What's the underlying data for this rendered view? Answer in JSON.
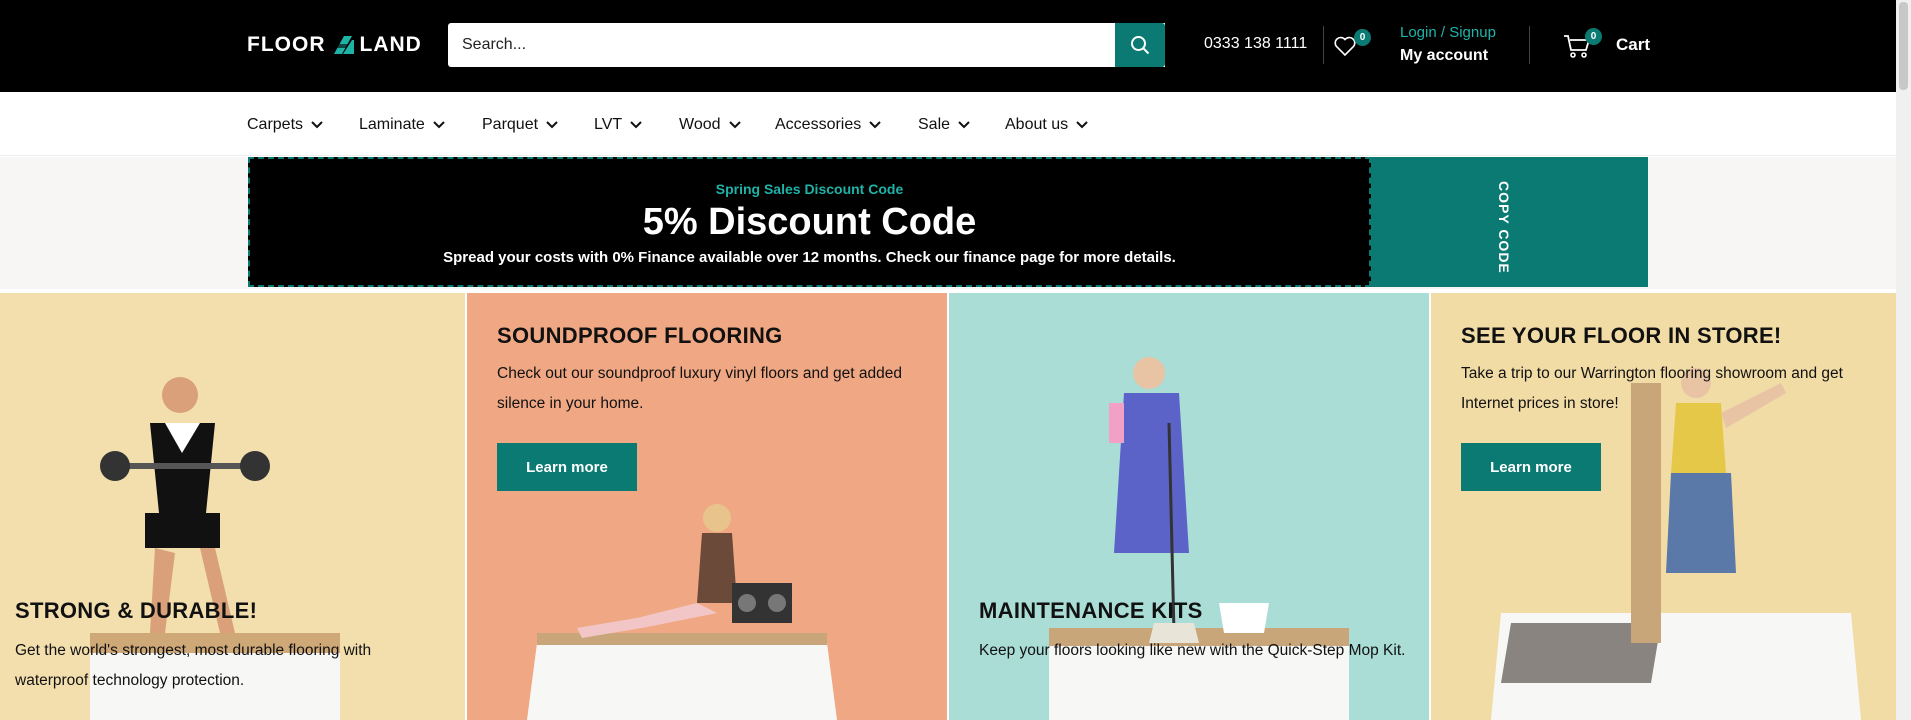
{
  "header": {
    "logo_left": "FLOOR",
    "logo_right": "LAND",
    "search_placeholder": "Search...",
    "phone": "0333 138 1111",
    "wishlist_count": "0",
    "login_label": "Login / Signup",
    "account_label": "My account",
    "cart_count": "0",
    "cart_label": "Cart"
  },
  "nav": {
    "items": [
      {
        "label": "Carpets"
      },
      {
        "label": "Laminate"
      },
      {
        "label": "Parquet"
      },
      {
        "label": "LVT"
      },
      {
        "label": "Wood"
      },
      {
        "label": "Accessories"
      },
      {
        "label": "Sale"
      },
      {
        "label": "About us"
      }
    ]
  },
  "promo": {
    "subtitle": "Spring Sales Discount Code",
    "title": "5% Discount Code",
    "description": "Spread your costs with 0% Finance available over 12 months. Check our finance page for more details.",
    "copy_label": "COPY CODE"
  },
  "panels": [
    {
      "title": "STRONG & DURABLE!",
      "text": "Get the world's strongest, most durable flooring with waterproof technology protection.",
      "bg": "#f3dfae"
    },
    {
      "title": "SOUNDPROOF FLOORING",
      "text": "Check out our soundproof luxury vinyl floors and get added silence in your home.",
      "button": "Learn more",
      "bg": "#f0a884"
    },
    {
      "title": "MAINTENANCE KITS",
      "text": "Keep your floors looking like new with the Quick-Step Mop Kit.",
      "bg": "#a9ddd6"
    },
    {
      "title": "SEE YOUR FLOOR IN STORE!",
      "text": "Take a trip to our Warrington flooring showroom and get Internet prices in store!",
      "button": "Learn more",
      "bg": "#f2dca6"
    }
  ],
  "colors": {
    "accent": "#0a7a73",
    "accent_light": "#1fb3a8",
    "header_bg": "#000000"
  }
}
